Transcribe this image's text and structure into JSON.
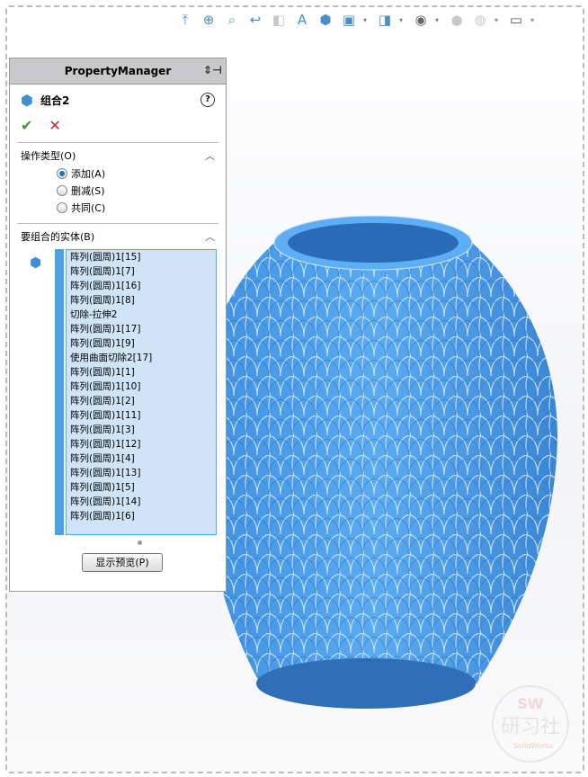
{
  "toolbar": {
    "icons": [
      "view-orientation-icon",
      "zoom-to-fit-icon",
      "zoom-to-area-icon",
      "previous-view-icon",
      "section-view-icon",
      "dynamic-annotation-icon",
      "display-style-icon",
      "hide-show-items-icon",
      "edit-appearance-icon",
      "view-visibility-icon",
      "apply-scene-icon",
      "view-settings-icon",
      "display-monitor-icon"
    ]
  },
  "property_manager": {
    "title": "PropertyManager",
    "feature_name": "组合2",
    "operation_section": {
      "title": "操作类型(O)",
      "options": [
        {
          "label": "添加(A)",
          "selected": true
        },
        {
          "label": "删减(S)",
          "selected": false
        },
        {
          "label": "共同(C)",
          "selected": false
        }
      ]
    },
    "bodies_section": {
      "title": "要组合的实体(B)",
      "items": [
        "阵列(圆周)1[15]",
        "阵列(圆周)1[7]",
        "阵列(圆周)1[16]",
        "阵列(圆周)1[8]",
        "切除-拉伸2",
        "阵列(圆周)1[17]",
        "阵列(圆周)1[9]",
        "使用曲面切除2[17]",
        "阵列(圆周)1[1]",
        "阵列(圆周)1[10]",
        "阵列(圆周)1[2]",
        "阵列(圆周)1[11]",
        "阵列(圆周)1[3]",
        "阵列(圆周)1[12]",
        "阵列(圆周)1[4]",
        "阵列(圆周)1[13]",
        "阵列(圆周)1[5]",
        "阵列(圆周)1[14]",
        "阵列(圆周)1[6]"
      ]
    },
    "preview_button": "显示预览(P)"
  },
  "watermark": {
    "line1": "SW",
    "line2": "研习社",
    "line3": "SolidWorks"
  },
  "colors": {
    "model": "#4a9be8",
    "selection_bg": "#cfe4f7",
    "accent": "#4aa3ea"
  }
}
